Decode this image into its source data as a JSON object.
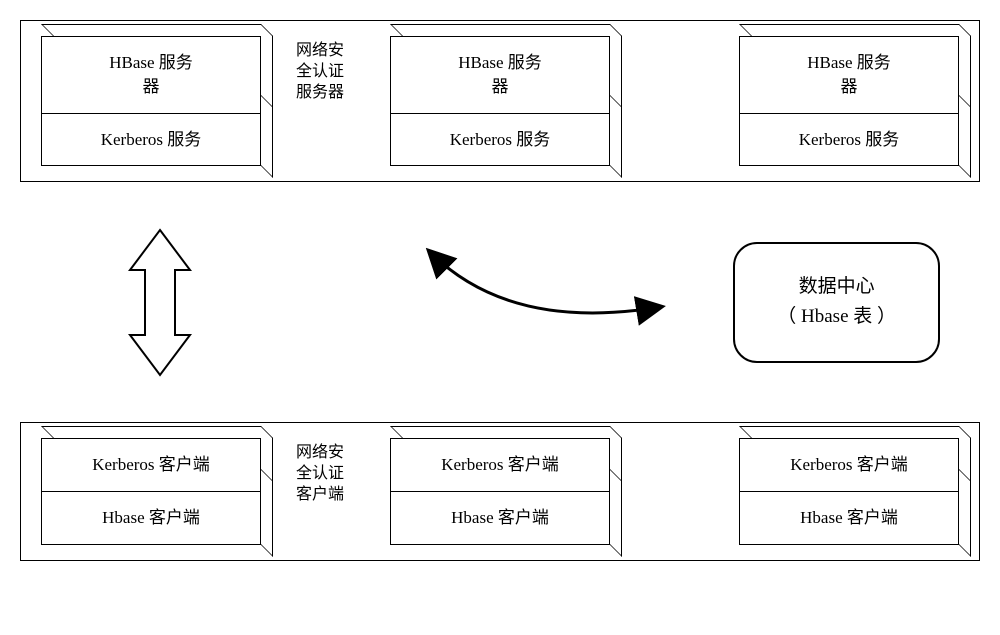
{
  "chart_data": {
    "type": "diagram",
    "title": "",
    "description": "Network security authentication architecture with HBase servers, Kerberos, and clients connected to data center"
  },
  "servers": {
    "side_label": "网络安\n全认证\n服务器",
    "items": [
      {
        "top": "HBase 服务\n器",
        "bottom": "Kerberos 服务"
      },
      {
        "top": "HBase 服务\n器",
        "bottom": "Kerberos 服务"
      },
      {
        "top": "HBase 服务\n器",
        "bottom": "Kerberos 服务"
      }
    ]
  },
  "clients": {
    "side_label": "网络安\n全认证\n客户端",
    "items": [
      {
        "top": "Kerberos 客户端",
        "bottom": "Hbase 客户端"
      },
      {
        "top": "Kerberos 客户端",
        "bottom": "Hbase 客户端"
      },
      {
        "top": "Kerberos 客户端",
        "bottom": "Hbase 客户端"
      }
    ]
  },
  "data_center": {
    "line1": "数据中心",
    "line2": "（ Hbase 表 ）"
  }
}
